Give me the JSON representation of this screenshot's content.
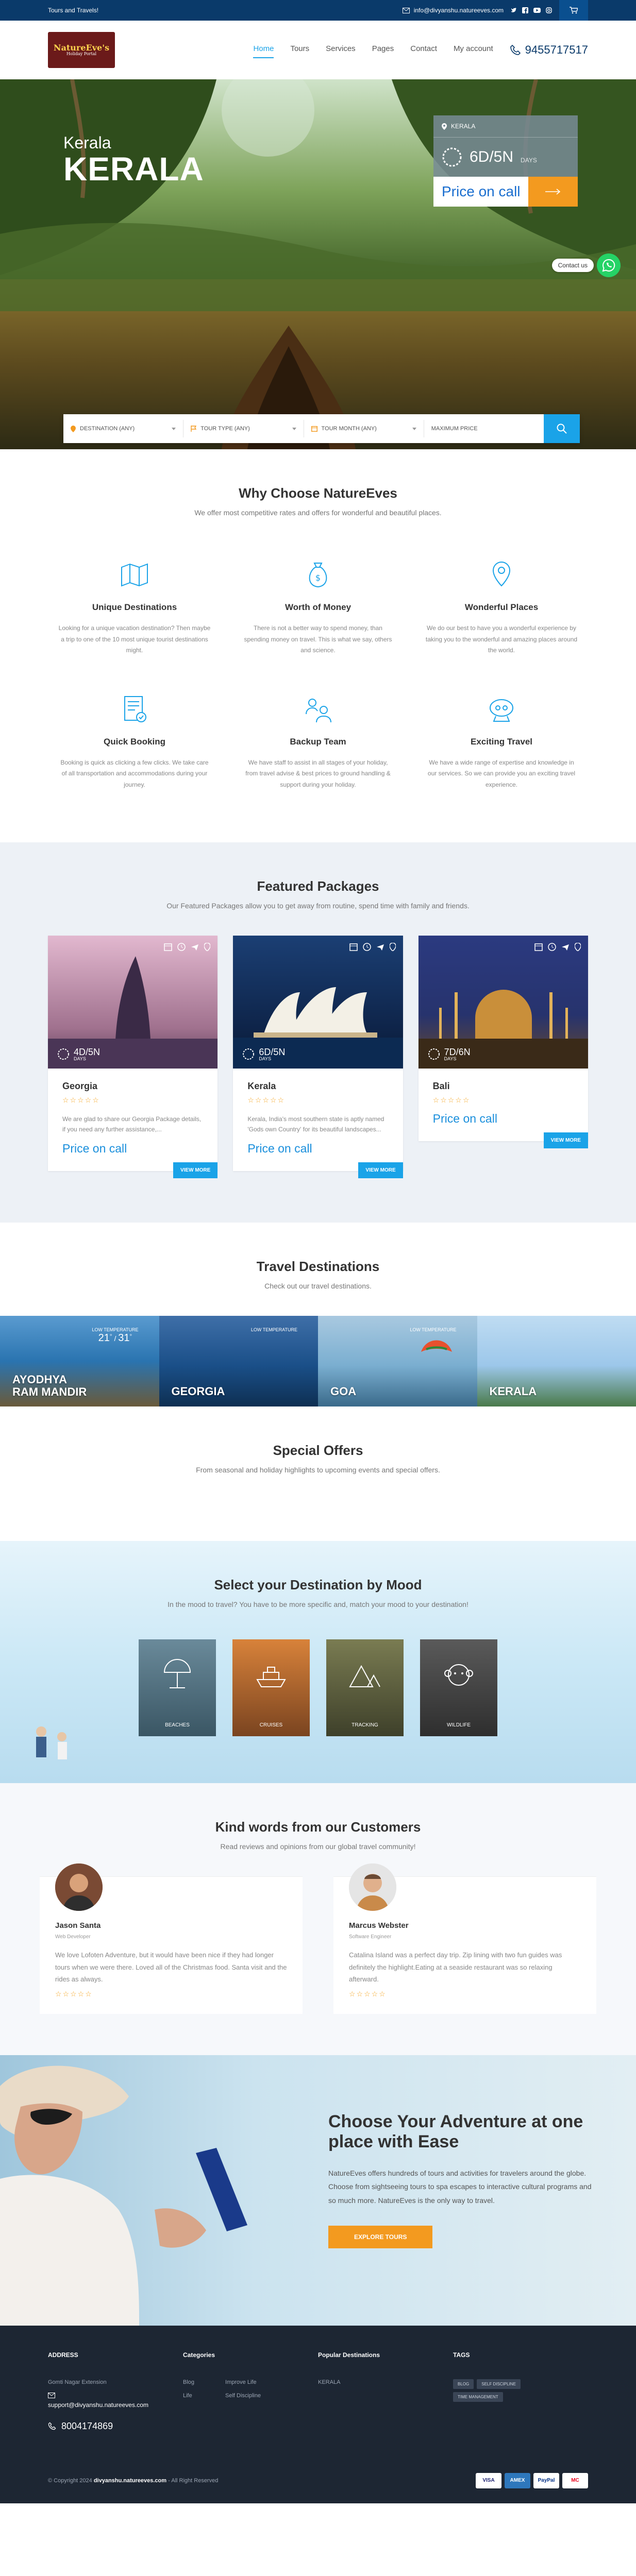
{
  "topbar": {
    "tagline": "Tours and Travels!",
    "email": "info@divyanshu.natureeves.com",
    "social_icons": [
      "twitter-icon",
      "facebook-icon",
      "youtube-icon",
      "instagram-icon"
    ],
    "cart_icon": "cart-icon"
  },
  "header": {
    "logo_main": "NatureEve's",
    "logo_sub": "Holiday Portal",
    "nav": [
      "Home",
      "Tours",
      "Services",
      "Pages",
      "Contact",
      "My account"
    ],
    "phone": "9455717517"
  },
  "hero": {
    "subtitle": "Kerala",
    "title": "KERALA",
    "card": {
      "location": "KERALA",
      "duration": "6D/5N",
      "duration_unit": "DAYS",
      "price_label": "Price on call"
    },
    "contact_label": "Contact us",
    "search": {
      "destination": "DESTINATION (ANY)",
      "tour_type": "TOUR TYPE (ANY)",
      "tour_month": "TOUR MONTH (ANY)",
      "max_price": "MAXIMUM PRICE"
    }
  },
  "why": {
    "title": "Why Choose NatureEves",
    "subtitle": "We offer most competitive rates and offers for wonderful and beautiful places.",
    "features": [
      {
        "icon": "map-icon",
        "title": "Unique Destinations",
        "text": "Looking for a unique vacation destination? Then maybe a trip to one of the 10 most unique tourist destinations might."
      },
      {
        "icon": "money-bag-icon",
        "title": "Worth of Money",
        "text": "There is not a better way to spend money, than spending money on travel. This is what we say, others and science."
      },
      {
        "icon": "location-pin-icon",
        "title": "Wonderful Places",
        "text": "We do our best to have you a wonderful experience by taking you to the wonderful and amazing places around the world."
      },
      {
        "icon": "booking-icon",
        "title": "Quick Booking",
        "text": "Booking is quick as clicking a few clicks. We take care of all transportation and accommodations during your journey."
      },
      {
        "icon": "team-icon",
        "title": "Backup Team",
        "text": "We have staff to assist in all stages of your holiday, from travel advise & best prices to ground handling & support during your holiday."
      },
      {
        "icon": "exciting-travel-icon",
        "title": "Exciting Travel",
        "text": "We have a wide range of expertise and knowledge in our services. So we can provide you an exciting travel experience."
      }
    ]
  },
  "packages": {
    "title": "Featured Packages",
    "subtitle": "Our Featured Packages allow you to get away from routine, spend time with family and friends.",
    "items": [
      {
        "name": "Georgia",
        "duration": "4D/5N",
        "unit": "DAYS",
        "desc": "We are glad to share our Georgia Package details, if you need any further assistance,...",
        "price": "Price on call",
        "more": "VIEW MORE",
        "bg": "#c38fae"
      },
      {
        "name": "Kerala",
        "duration": "6D/5N",
        "unit": "DAYS",
        "desc": "Kerala, India's most southern state is aptly named 'Gods own Country' for its beautiful landscapes...",
        "price": "Price on call",
        "more": "VIEW MORE",
        "bg": "#1b3f74"
      },
      {
        "name": "Bali",
        "duration": "7D/6N",
        "unit": "DAYS",
        "desc": "",
        "price": "Price on call",
        "more": "VIEW MORE",
        "bg": "#27336d"
      }
    ]
  },
  "destinations": {
    "title": "Travel Destinations",
    "subtitle": "Check out our travel destinations.",
    "items": [
      {
        "name": "AYODHYA RAM MANDIR",
        "temp_label": "LOW TEMPERATURE",
        "t1": "21",
        "t2": "31",
        "bg": "#2a74b0"
      },
      {
        "name": "GEORGIA",
        "temp_label": "LOW TEMPERATURE",
        "t1": "",
        "t2": "",
        "bg": "#1a4f88"
      },
      {
        "name": "GOA",
        "temp_label": "LOW TEMPERATURE",
        "t1": "",
        "t2": "",
        "bg": "#7aaed0"
      },
      {
        "name": "KERALA",
        "temp_label": "",
        "t1": "",
        "t2": "",
        "bg": "#9cc7ea"
      }
    ]
  },
  "offers": {
    "title": "Special Offers",
    "subtitle": "From seasonal and holiday highlights to upcoming events and special offers."
  },
  "mood": {
    "title": "Select your Destination by Mood",
    "subtitle": "In the mood to travel? You have to be more specific and, match your mood to your destination!",
    "items": [
      {
        "label": "BEACHES",
        "icon": "beach-umbrella-icon",
        "bg": "#4a6b7a"
      },
      {
        "label": "CRUISES",
        "icon": "cruise-ship-icon",
        "bg": "#b56b2e"
      },
      {
        "label": "TRACKING",
        "icon": "mountain-tent-icon",
        "bg": "#5c5e3c"
      },
      {
        "label": "WILDLIFE",
        "icon": "monkey-icon",
        "bg": "#474747"
      }
    ]
  },
  "testimonials": {
    "title": "Kind words from our Customers",
    "subtitle": "Read reviews and opinions from our global travel community!",
    "items": [
      {
        "name": "Jason Santa",
        "role": "Web Developer",
        "text": "We love Lofoten Adventure, but it would have been nice if they had longer tours when we were there. Loved all of the Christmas food. Santa visit and the rides as always."
      },
      {
        "name": "Marcus Webster",
        "role": "Software Engineer",
        "text": "Catalina Island was a perfect day trip. Zip lining with two fun guides was definitely the highlight.Eating at a seaside restaurant was so relaxing afterward."
      }
    ]
  },
  "adventure": {
    "title": "Choose Your Adventure at one place with Ease",
    "text": "NatureEves offers hundreds of tours and activities for travelers around the globe. Choose from sightseeing tours to spa escapes to interactive cultural programs and so much more. NatureEves is the only way to travel.",
    "button": "EXPLORE TOURS"
  },
  "footer": {
    "address_title": "ADDRESS",
    "address": "Gomti Nagar Extension",
    "email": "support@divyanshu.natureeves.com",
    "phone": "8004174869",
    "categories_title": "Categories",
    "categories": [
      "Blog",
      "Life"
    ],
    "categories2": [
      "Improve Life",
      "Self Discipline"
    ],
    "popular_title": "Popular Destinations",
    "popular": [
      "KERALA"
    ],
    "tags_title": "TAGS",
    "tags": [
      "BLOG",
      "SELF DISCIPLINE",
      "TIME MANAGEMENT"
    ],
    "copyright_pre": "© Copyright 2024",
    "copyright_site": "divyanshu.natureeves.com",
    "copyright_post": "- All Right Reserved",
    "payments": [
      "VISA",
      "AMEX",
      "PayPal",
      "MC"
    ]
  },
  "colors": {
    "accent": "#1aa3e8",
    "orange": "#f39a1f",
    "navy": "#0a3a6a",
    "footer": "#1d2633"
  }
}
